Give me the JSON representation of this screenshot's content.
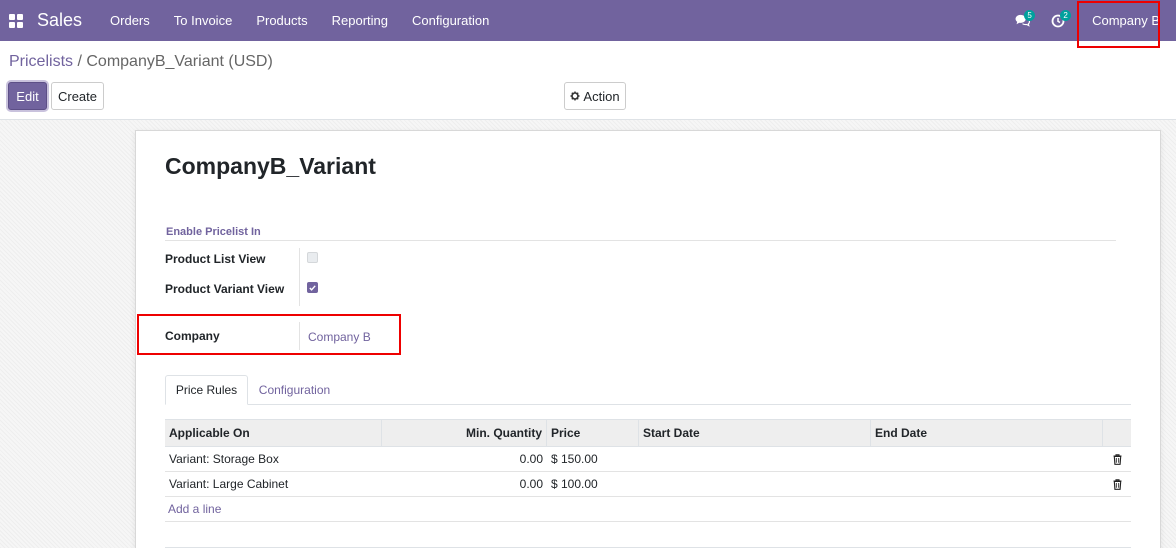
{
  "navbar": {
    "app_name": "Sales",
    "menu": [
      "Orders",
      "To Invoice",
      "Products",
      "Reporting",
      "Configuration"
    ],
    "messages_count": "5",
    "activities_count": "2",
    "company": "Company B"
  },
  "breadcrumb": {
    "parent": "Pricelists",
    "separator": "/",
    "current": "CompanyB_Variant (USD)"
  },
  "buttons": {
    "edit": "Edit",
    "create": "Create",
    "action": "Action"
  },
  "form": {
    "title": "CompanyB_Variant",
    "group_title": "Enable Pricelist In",
    "product_list_view_label": "Product List View",
    "product_list_view_checked": false,
    "product_variant_view_label": "Product Variant View",
    "product_variant_view_checked": true,
    "company_label": "Company",
    "company_value": "Company B"
  },
  "tabs": [
    "Price Rules",
    "Configuration"
  ],
  "table": {
    "columns": [
      "Applicable On",
      "Min. Quantity",
      "Price",
      "Start Date",
      "End Date"
    ],
    "rows": [
      {
        "applicable_on": "Variant: Storage Box",
        "min_qty": "0.00",
        "price": "$ 150.00",
        "start": "",
        "end": ""
      },
      {
        "applicable_on": "Variant: Large Cabinet",
        "min_qty": "0.00",
        "price": "$ 100.00",
        "start": "",
        "end": ""
      }
    ],
    "add_line": "Add a line"
  },
  "colors": {
    "brand": "#71639e",
    "highlight": "#ee0000",
    "badge": "#00a09d"
  }
}
